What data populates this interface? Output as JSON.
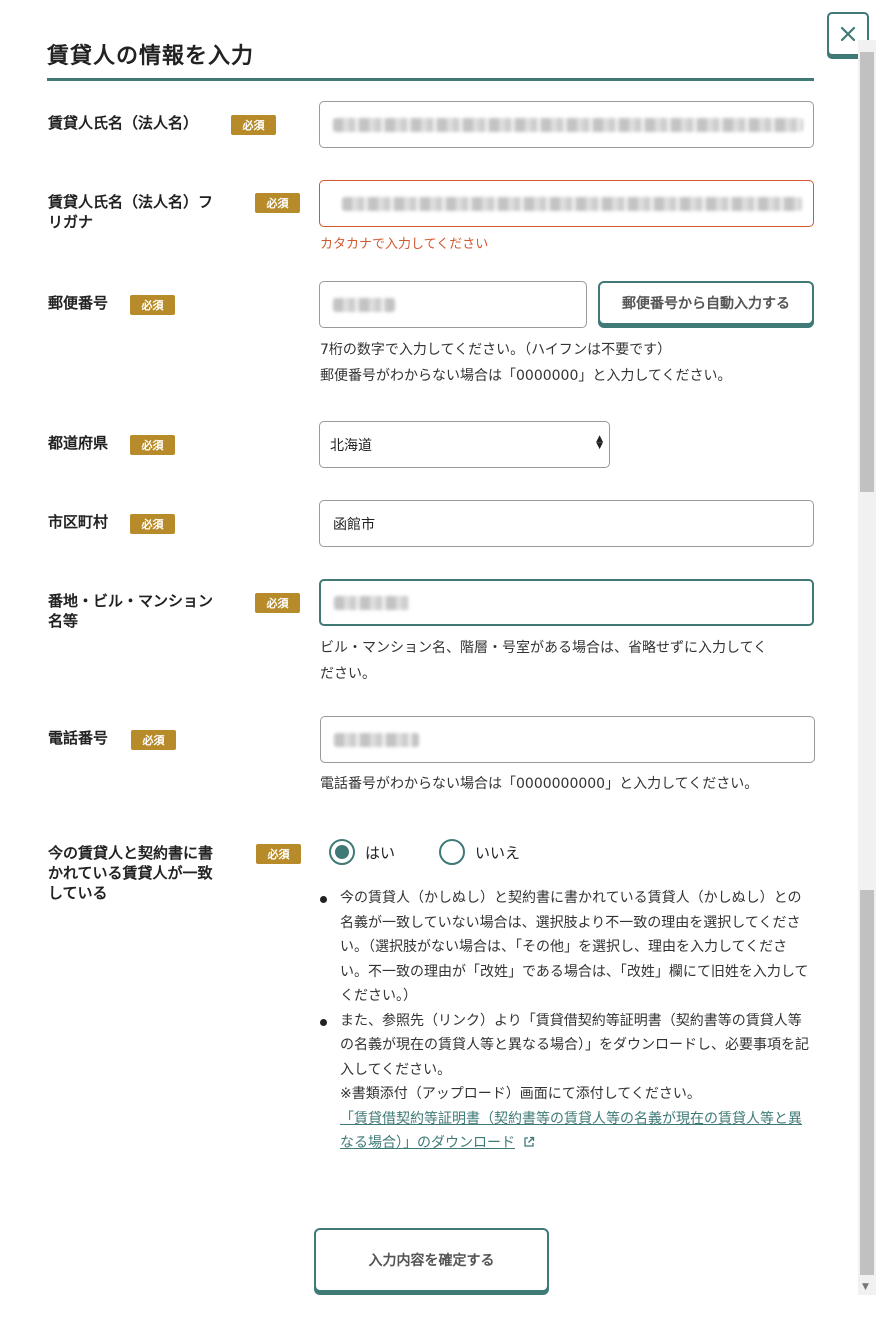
{
  "modal": {
    "title": "賃貸人の情報を入力",
    "close_label": "×",
    "required_badge": "必須"
  },
  "fields": {
    "name": {
      "label": "賃貸人氏名（法人名）"
    },
    "name_kana": {
      "label_line1": "賃貸人氏名（法人名）フ",
      "label_line2": "リガナ",
      "error": "カタカナで入力してください"
    },
    "postal": {
      "label": "郵便番号",
      "autofill_button": "郵便番号から自動入力する",
      "help_line1": "7桁の数字で入力してください。（ハイフンは不要です）",
      "help_line2": "郵便番号がわからない場合は「0000000」と入力してください。"
    },
    "prefecture": {
      "label": "都道府県",
      "value": "北海道"
    },
    "city": {
      "label": "市区町村",
      "value": "函館市"
    },
    "address": {
      "label_line1": "番地・ビル・マンション",
      "label_line2": "名等",
      "help_line1": "ビル・マンション名、階層・号室がある場合は、省略せずに入力してく",
      "help_line2": "ださい。"
    },
    "phone": {
      "label": "電話番号",
      "help": "電話番号がわからない場合は「0000000000」と入力してください。"
    },
    "match": {
      "label_line1": "今の賃貸人と契約書に書",
      "label_line2": "かれている賃貸人が一致",
      "label_line3": "している",
      "option_yes": "はい",
      "option_no": "いいえ",
      "selected": "はい",
      "note1": "今の賃貸人（かしぬし）と契約書に書かれている賃貸人（かしぬし）との名義が一致していない場合は、選択肢より不一致の理由を選択してください。（選択肢がない場合は、「その他」を選択し、理由を入力してください。不一致の理由が「改姓」である場合は、「改姓」欄にて旧姓を入力してください。）",
      "note2": "また、参照先（リンク）より「賃貸借契約等証明書（契約書等の賃貸人等の名義が現在の賃貸人等と異なる場合）」をダウンロードし、必要事項を記入してください。",
      "note3": "※書類添付（アップロード）画面にて添付してください。",
      "link": "「賃貸借契約等証明書（契約書等の賃貸人等の名義が現在の賃貸人等と異なる場合）」のダウンロード"
    }
  },
  "submit_label": "入力内容を確定する",
  "colors": {
    "accent": "#3f7a77",
    "badge": "#b88b2a",
    "error": "#d2582e"
  }
}
